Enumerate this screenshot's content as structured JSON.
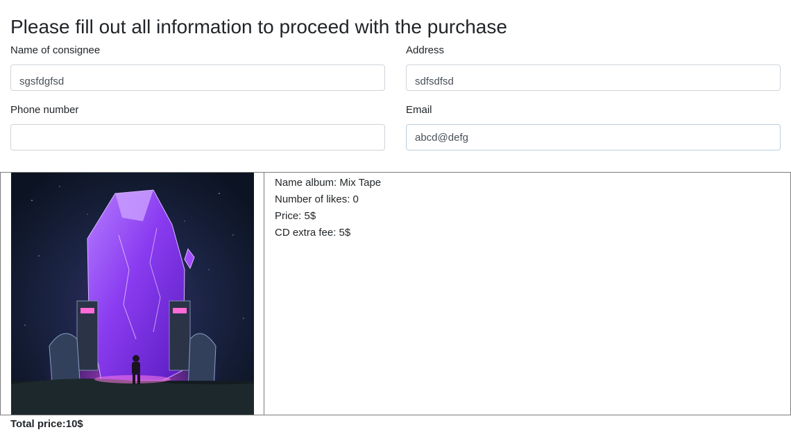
{
  "heading": "Please fill out all information to proceed with the purchase",
  "form": {
    "consignee": {
      "label": "Name of consignee",
      "value": "sgsfdgfsd"
    },
    "address": {
      "label": "Address",
      "value": "sdfsdfsd"
    },
    "phone": {
      "label": "Phone number",
      "value": ""
    },
    "email": {
      "label": "Email",
      "value": "abcd@defg"
    }
  },
  "album": {
    "cover_icon": "crystal-portal-album-art",
    "name_label": "Name album: ",
    "name": "Mix Tape",
    "likes_label": "Number of likes: ",
    "likes": "0",
    "price_label": "Price: ",
    "price": "5$",
    "cd_fee_label": "CD extra fee: ",
    "cd_fee": "5$"
  },
  "total": {
    "label": "Total price:",
    "value": "10$"
  }
}
